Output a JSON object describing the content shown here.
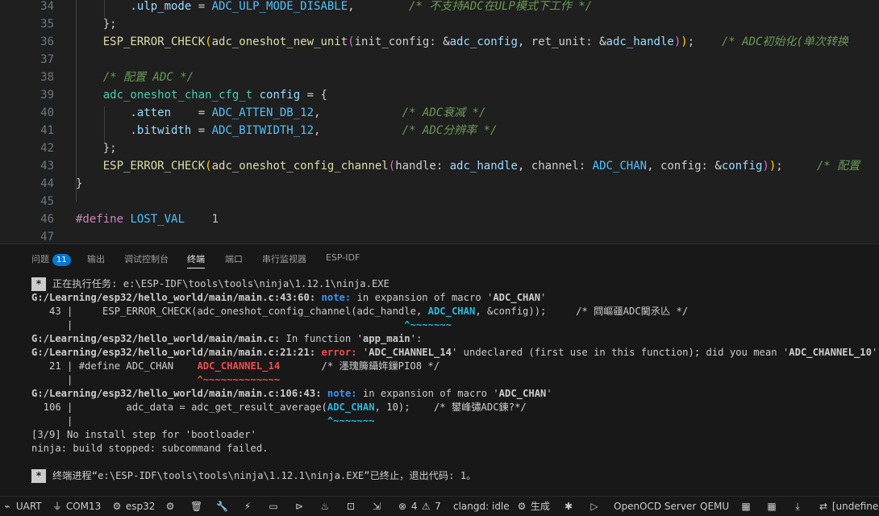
{
  "editor": {
    "lines": [
      {
        "n": "34",
        "segs": [
          {
            "c": "plain",
            "t": "        ."
          },
          {
            "c": "var",
            "t": "ulp_mode"
          },
          {
            "c": "plain",
            "t": " = "
          },
          {
            "c": "const",
            "t": "ADC_ULP_MODE_DISABLE"
          },
          {
            "c": "plain",
            "t": ",        "
          },
          {
            "c": "cmt",
            "t": "/* 不支持ADC在ULP模式下工作 */"
          }
        ]
      },
      {
        "n": "35",
        "segs": [
          {
            "c": "plain",
            "t": "    };"
          }
        ]
      },
      {
        "n": "36",
        "segs": [
          {
            "c": "plain",
            "t": "    "
          },
          {
            "c": "fn",
            "t": "ESP_ERROR_CHECK"
          },
          {
            "c": "br1",
            "t": "("
          },
          {
            "c": "fn",
            "t": "adc_oneshot_new_unit"
          },
          {
            "c": "br2",
            "t": "("
          },
          {
            "c": "hint",
            "t": "init_config: "
          },
          {
            "c": "amp",
            "t": "&"
          },
          {
            "c": "var",
            "t": "adc_config"
          },
          {
            "c": "plain",
            "t": ", "
          },
          {
            "c": "hint",
            "t": "ret_unit: "
          },
          {
            "c": "amp",
            "t": "&"
          },
          {
            "c": "var",
            "t": "adc_handle"
          },
          {
            "c": "br2",
            "t": ")"
          },
          {
            "c": "br1",
            "t": ")"
          },
          {
            "c": "plain",
            "t": ";    "
          },
          {
            "c": "cmt",
            "t": "/* ADC初始化(单次转换"
          }
        ]
      },
      {
        "n": "37",
        "segs": []
      },
      {
        "n": "38",
        "segs": [
          {
            "c": "plain",
            "t": "    "
          },
          {
            "c": "cmt",
            "t": "/* 配置 ADC */"
          }
        ]
      },
      {
        "n": "39",
        "segs": [
          {
            "c": "plain",
            "t": "    "
          },
          {
            "c": "type",
            "t": "adc_oneshot_chan_cfg_t"
          },
          {
            "c": "plain",
            "t": " "
          },
          {
            "c": "var",
            "t": "config"
          },
          {
            "c": "plain",
            "t": " = {"
          }
        ]
      },
      {
        "n": "40",
        "segs": [
          {
            "c": "plain",
            "t": "        ."
          },
          {
            "c": "var",
            "t": "atten"
          },
          {
            "c": "plain",
            "t": "    = "
          },
          {
            "c": "const",
            "t": "ADC_ATTEN_DB_12"
          },
          {
            "c": "plain",
            "t": ",            "
          },
          {
            "c": "cmt",
            "t": "/* ADC衰减 */"
          }
        ]
      },
      {
        "n": "41",
        "segs": [
          {
            "c": "plain",
            "t": "        ."
          },
          {
            "c": "var",
            "t": "bitwidth"
          },
          {
            "c": "plain",
            "t": " = "
          },
          {
            "c": "const",
            "t": "ADC_BITWIDTH_12"
          },
          {
            "c": "plain",
            "t": ",            "
          },
          {
            "c": "cmt",
            "t": "/* ADC分辨率 */"
          }
        ]
      },
      {
        "n": "42",
        "segs": [
          {
            "c": "plain",
            "t": "    };"
          }
        ]
      },
      {
        "n": "43",
        "segs": [
          {
            "c": "plain",
            "t": "    "
          },
          {
            "c": "fn",
            "t": "ESP_ERROR_CHECK"
          },
          {
            "c": "br1",
            "t": "("
          },
          {
            "c": "fn",
            "t": "adc_oneshot_config_channel"
          },
          {
            "c": "br2",
            "t": "("
          },
          {
            "c": "hint",
            "t": "handle: "
          },
          {
            "c": "var",
            "t": "adc_handle"
          },
          {
            "c": "plain",
            "t": ", "
          },
          {
            "c": "hint",
            "t": "channel: "
          },
          {
            "c": "const",
            "t": "ADC_CHAN"
          },
          {
            "c": "plain",
            "t": ", "
          },
          {
            "c": "hint",
            "t": "config: "
          },
          {
            "c": "amp",
            "t": "&"
          },
          {
            "c": "var",
            "t": "config"
          },
          {
            "c": "br2",
            "t": ")"
          },
          {
            "c": "br1",
            "t": ")"
          },
          {
            "c": "plain",
            "t": ";     "
          },
          {
            "c": "cmt",
            "t": "/* 配置"
          }
        ]
      },
      {
        "n": "44",
        "segs": [
          {
            "c": "plain",
            "t": "}"
          }
        ]
      },
      {
        "n": "45",
        "segs": []
      },
      {
        "n": "46",
        "segs": [
          {
            "c": "kw",
            "t": "#define"
          },
          {
            "c": "plain",
            "t": " "
          },
          {
            "c": "const",
            "t": "LOST_VAL"
          },
          {
            "c": "plain",
            "t": "    "
          },
          {
            "c": "num",
            "t": "1"
          }
        ]
      },
      {
        "n": "47",
        "segs": []
      }
    ]
  },
  "panel": {
    "tabs": [
      {
        "label": "问题",
        "badge": "11"
      },
      {
        "label": "输出"
      },
      {
        "label": "调试控制台"
      },
      {
        "label": "终端",
        "active": true
      },
      {
        "label": "端口"
      },
      {
        "label": "串行监视器"
      },
      {
        "label": "ESP-IDF"
      }
    ]
  },
  "terminal": {
    "lines": [
      {
        "star": "*",
        "segs": [
          {
            "c": "normal",
            "t": "正在执行任务: e:\\ESP-IDF\\tools\\tools\\ninja\\1.12.1\\ninja.EXE"
          }
        ]
      },
      {
        "segs": [
          {
            "c": "bold",
            "t": "G:/Learning/esp32/hello_world/main/main.c:43:60: "
          },
          {
            "c": "note",
            "t": "note:"
          },
          {
            "c": "normal",
            "t": " in expansion of macro '"
          },
          {
            "c": "bold",
            "t": "ADC_CHAN"
          },
          {
            "c": "normal",
            "t": "'"
          }
        ]
      },
      {
        "segs": [
          {
            "c": "normal",
            "t": "   43 |     ESP_ERROR_CHECK(adc_oneshot_config_channel(adc_handle, "
          },
          {
            "c": "cyan",
            "t": "ADC_CHAN"
          },
          {
            "c": "normal",
            "t": ", &config));     /* 閰嶇疆ADC閫氶亾 */"
          }
        ]
      },
      {
        "segs": [
          {
            "c": "normal",
            "t": "      |                                                        "
          },
          {
            "c": "cyan",
            "t": "^~~~~~~~"
          }
        ]
      },
      {
        "segs": [
          {
            "c": "bold",
            "t": "G:/Learning/esp32/hello_world/main/main.c:"
          },
          {
            "c": "normal",
            "t": " In function '"
          },
          {
            "c": "bold",
            "t": "app_main"
          },
          {
            "c": "normal",
            "t": "':"
          }
        ]
      },
      {
        "segs": [
          {
            "c": "bold",
            "t": "G:/Learning/esp32/hello_world/main/main.c:21:21: "
          },
          {
            "c": "error",
            "t": "error:"
          },
          {
            "c": "normal",
            "t": " '"
          },
          {
            "c": "bold",
            "t": "ADC_CHANNEL_14"
          },
          {
            "c": "normal",
            "t": "' undeclared (first use in this function); did you mean '"
          },
          {
            "c": "bold",
            "t": "ADC_CHANNEL_10"
          },
          {
            "c": "normal",
            "t": "'?"
          }
        ]
      },
      {
        "segs": [
          {
            "c": "normal",
            "t": "   21 | #define ADC_CHAN    "
          },
          {
            "c": "red",
            "t": "ADC_CHANNEL_14"
          },
          {
            "c": "normal",
            "t": "       /* 濹瑰簲鑷姩鏁PIO8 */"
          }
        ]
      },
      {
        "segs": [
          {
            "c": "normal",
            "t": "      |                     "
          },
          {
            "c": "red",
            "t": "^~~~~~~~~~~~~~"
          }
        ]
      },
      {
        "segs": [
          {
            "c": "bold",
            "t": "G:/Learning/esp32/hello_world/main/main.c:106:43: "
          },
          {
            "c": "note",
            "t": "note:"
          },
          {
            "c": "normal",
            "t": " in expansion of macro '"
          },
          {
            "c": "bold",
            "t": "ADC_CHAN"
          },
          {
            "c": "normal",
            "t": "'"
          }
        ]
      },
      {
        "segs": [
          {
            "c": "normal",
            "t": "  106 |         adc_data = adc_get_result_average("
          },
          {
            "c": "cyan",
            "t": "ADC_CHAN"
          },
          {
            "c": "normal",
            "t": ", 10);    /* 鐢峰彇ADC鍊?*/"
          }
        ]
      },
      {
        "segs": [
          {
            "c": "normal",
            "t": "      |                                           "
          },
          {
            "c": "cyan",
            "t": "^~~~~~~~"
          }
        ]
      },
      {
        "segs": [
          {
            "c": "normal",
            "t": "[3/9] No install step for 'bootloader'"
          }
        ]
      },
      {
        "segs": [
          {
            "c": "normal",
            "t": "ninja: build stopped: subcommand failed."
          }
        ]
      },
      {
        "segs": []
      },
      {
        "star": "*",
        "segs": [
          {
            "c": "normal",
            "t": "终端进程“e:\\ESP-IDF\\tools\\tools\\ninja\\1.12.1\\ninja.EXE”已终止，退出代码: 1。"
          }
        ]
      }
    ]
  },
  "statusbar": {
    "uart": "UART",
    "com": "COM13",
    "target": "esp32",
    "errors": "4",
    "warnings": "7",
    "clangd": "clangd: idle",
    "build": "生成",
    "openocd": "OpenOCD Server",
    "qemu": "QEMU",
    "undefined": "[undefined"
  }
}
